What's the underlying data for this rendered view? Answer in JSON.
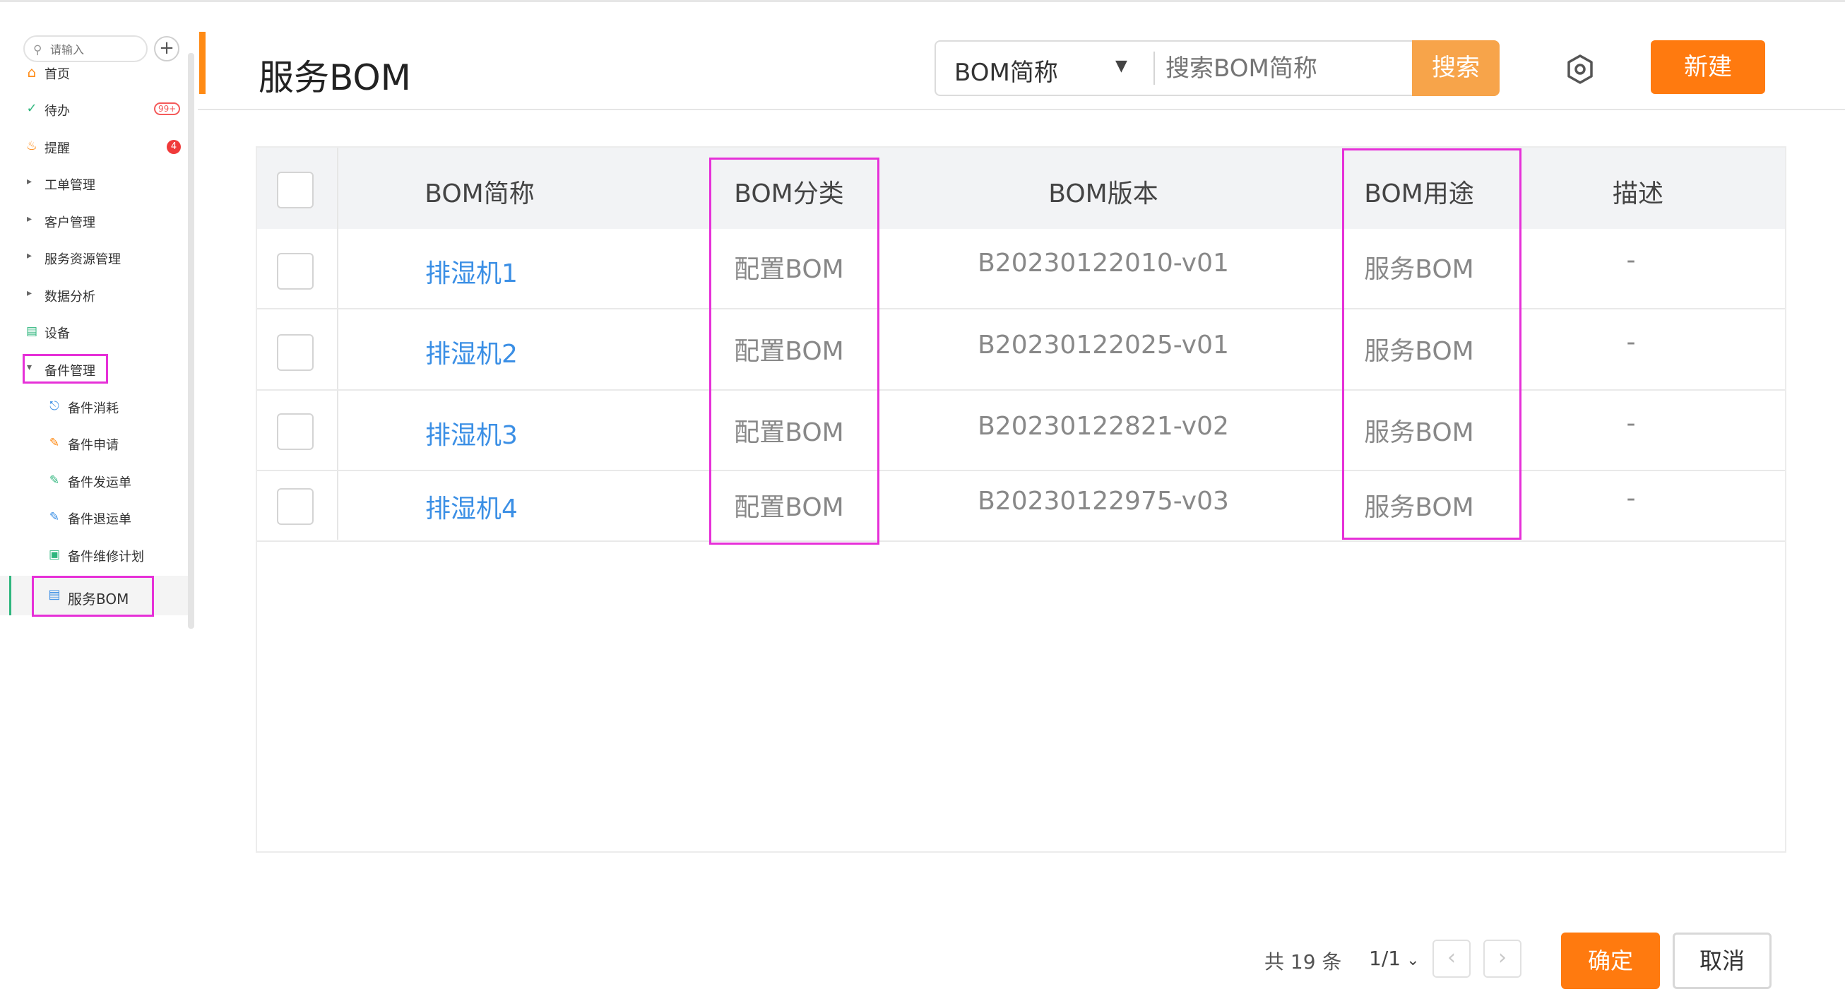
{
  "sidebar": {
    "search_placeholder": "请输入",
    "add_symbol": "+",
    "items": [
      {
        "label": "首页",
        "icon": "home-icon"
      },
      {
        "label": "待办",
        "icon": "check-circle-icon",
        "badge": "99+"
      },
      {
        "label": "提醒",
        "icon": "bell-icon",
        "badge": "4"
      },
      {
        "label": "工单管理",
        "icon": "caret-right-icon"
      },
      {
        "label": "客户管理",
        "icon": "caret-right-icon"
      },
      {
        "label": "服务资源管理",
        "icon": "caret-right-icon"
      },
      {
        "label": "数据分析",
        "icon": "caret-right-icon"
      },
      {
        "label": "设备",
        "icon": "device-icon"
      },
      {
        "label": "备件管理",
        "icon": "caret-down-icon",
        "expanded": true
      }
    ],
    "sub_items": [
      {
        "label": "备件消耗",
        "icon": "plug-icon"
      },
      {
        "label": "备件申请",
        "icon": "doc-request-icon"
      },
      {
        "label": "备件发运单",
        "icon": "doc-ship-icon"
      },
      {
        "label": "备件退运单",
        "icon": "doc-return-icon"
      },
      {
        "label": "备件维修计划",
        "icon": "calendar-icon"
      },
      {
        "label": "服务BOM",
        "icon": "list-doc-icon",
        "active": true
      }
    ]
  },
  "header": {
    "title": "服务BOM",
    "search_field": "BOM简称",
    "search_placeholder": "搜索BOM简称",
    "search_button": "搜索",
    "new_button": "新建"
  },
  "table": {
    "columns": [
      "BOM简称",
      "BOM分类",
      "BOM版本",
      "BOM用途",
      "描述"
    ],
    "rows": [
      {
        "name": "排湿机1",
        "category": "配置BOM",
        "version": "B20230122010-v01",
        "usage": "服务BOM",
        "desc": "-"
      },
      {
        "name": "排湿机2",
        "category": "配置BOM",
        "version": "B20230122025-v01",
        "usage": "服务BOM",
        "desc": "-"
      },
      {
        "name": "排湿机3",
        "category": "配置BOM",
        "version": "B20230122821-v02",
        "usage": "服务BOM",
        "desc": "-"
      },
      {
        "name": "排湿机4",
        "category": "配置BOM",
        "version": "B20230122975-v03",
        "usage": "服务BOM",
        "desc": "-"
      }
    ]
  },
  "footer": {
    "total": "共 19 条",
    "page": "1/1",
    "prev": "‹",
    "next": "›",
    "confirm": "确定",
    "cancel": "取消"
  },
  "colors": {
    "accent": "#ff7a0f",
    "link": "#3b8fe5",
    "highlight_box": "#e630d8",
    "active_bar": "#2eb67d"
  }
}
